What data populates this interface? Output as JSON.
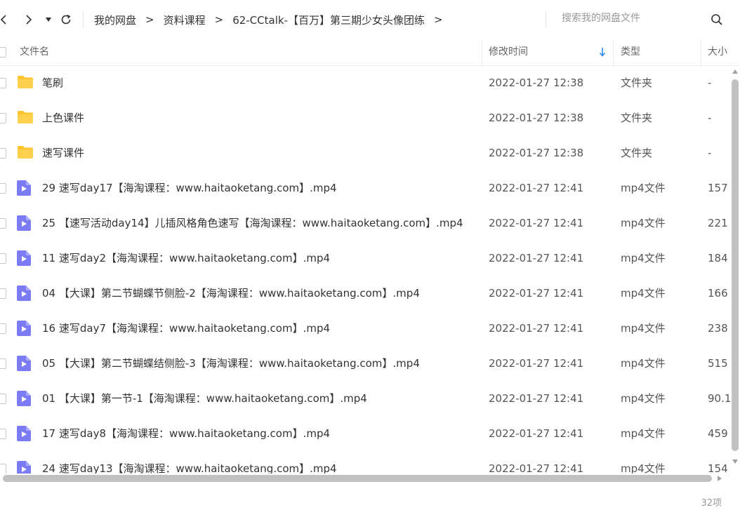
{
  "toolbar": {
    "breadcrumb": [
      "我的网盘",
      "资料课程",
      "62-CCtalk-【百万】第三期少女头像团练"
    ],
    "separator": ">",
    "search_placeholder": "搜索我的网盘文件"
  },
  "columns": {
    "name": "文件名",
    "modified": "修改时间",
    "type": "类型",
    "size": "大小"
  },
  "rows": [
    {
      "icon": "folder-icon",
      "name": "笔刷",
      "modified": "2022-01-27 12:38",
      "type": "文件夹",
      "size": "-"
    },
    {
      "icon": "folder-icon",
      "name": "上色课件",
      "modified": "2022-01-27 12:38",
      "type": "文件夹",
      "size": "-"
    },
    {
      "icon": "folder-icon",
      "name": "速写课件",
      "modified": "2022-01-27 12:38",
      "type": "文件夹",
      "size": "-"
    },
    {
      "icon": "video-file-icon",
      "name": "29 速写day17【海淘课程：www.haitaoketang.com】.mp4",
      "modified": "2022-01-27 12:41",
      "type": "mp4文件",
      "size": "157"
    },
    {
      "icon": "video-file-icon",
      "name": "25 【速写活动day14】儿插风格角色速写【海淘课程：www.haitaoketang.com】.mp4",
      "modified": "2022-01-27 12:41",
      "type": "mp4文件",
      "size": "221"
    },
    {
      "icon": "video-file-icon",
      "name": "11 速写day2【海淘课程：www.haitaoketang.com】.mp4",
      "modified": "2022-01-27 12:41",
      "type": "mp4文件",
      "size": "184"
    },
    {
      "icon": "video-file-icon",
      "name": "04 【大课】第二节蝴蝶节侧脸-2【海淘课程：www.haitaoketang.com】.mp4",
      "modified": "2022-01-27 12:41",
      "type": "mp4文件",
      "size": "166"
    },
    {
      "icon": "video-file-icon",
      "name": "16 速写day7【海淘课程：www.haitaoketang.com】.mp4",
      "modified": "2022-01-27 12:41",
      "type": "mp4文件",
      "size": "238"
    },
    {
      "icon": "video-file-icon",
      "name": "05 【大课】第二节蝴蝶结侧脸-3【海淘课程：www.haitaoketang.com】.mp4",
      "modified": "2022-01-27 12:41",
      "type": "mp4文件",
      "size": "515"
    },
    {
      "icon": "video-file-icon",
      "name": "01 【大课】第一节-1【海淘课程：www.haitaoketang.com】.mp4",
      "modified": "2022-01-27 12:41",
      "type": "mp4文件",
      "size": "90.1"
    },
    {
      "icon": "video-file-icon",
      "name": "17 速写day8【海淘课程：www.haitaoketang.com】.mp4",
      "modified": "2022-01-27 12:41",
      "type": "mp4文件",
      "size": "459"
    },
    {
      "icon": "video-file-icon",
      "name": "24 速写day13【海淘课程：www.haitaoketang.com】.mp4",
      "modified": "2022-01-27 12:41",
      "type": "mp4文件",
      "size": "154"
    }
  ],
  "footer": {
    "item_count": "32项"
  },
  "colors": {
    "folder": "#FFC42E",
    "video": "#7B7CF5",
    "sort_arrow": "#2B8CF2",
    "scrollbar": "#C1C1C1"
  }
}
